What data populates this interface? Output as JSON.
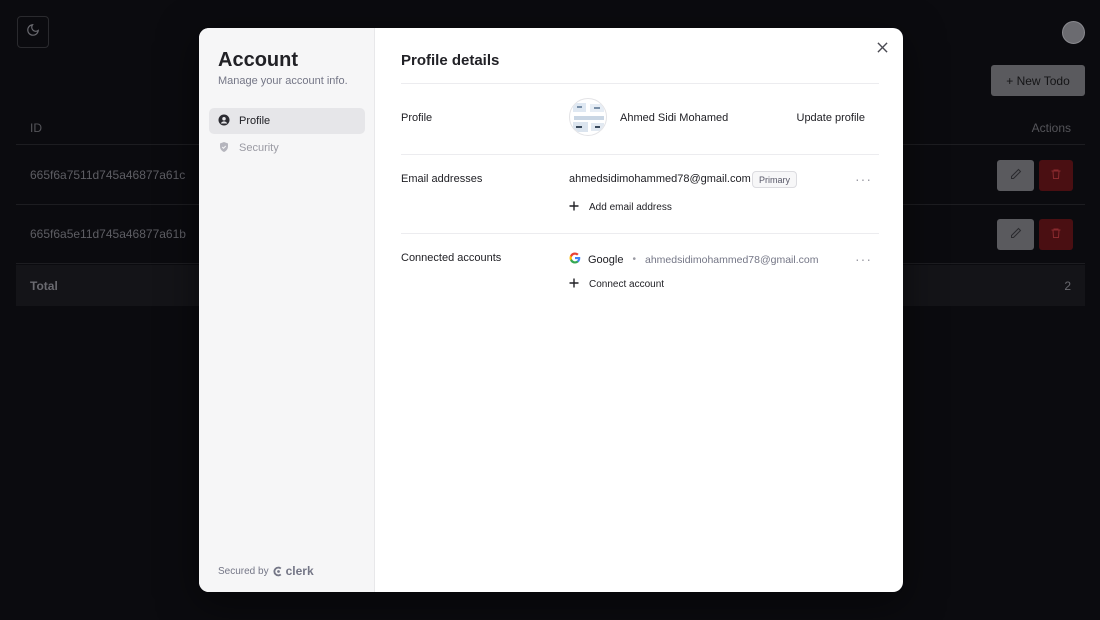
{
  "background": {
    "new_todo_label": "+ New Todo",
    "table": {
      "headers": [
        "ID",
        "Actions"
      ],
      "rows": [
        {
          "id": "665f6a7511d745a46877a61c"
        },
        {
          "id": "665f6a5e11d745a46877a61b"
        }
      ],
      "total_label": "Total",
      "total_value": "2"
    }
  },
  "modal": {
    "nav": {
      "title": "Account",
      "subtitle": "Manage your account info.",
      "items": [
        {
          "label": "Profile",
          "icon": "user-circle-icon",
          "active": true
        },
        {
          "label": "Security",
          "icon": "shield-icon",
          "active": false
        }
      ],
      "secured_by": "Secured by",
      "brand": "clerk"
    },
    "content": {
      "title": "Profile details",
      "profile": {
        "label": "Profile",
        "name": "Ahmed Sidi Mohamed",
        "update_label": "Update profile"
      },
      "email": {
        "label": "Email addresses",
        "address": "ahmedsidimohammed78@gmail.com",
        "badge": "Primary",
        "add_label": "Add email address"
      },
      "connected": {
        "label": "Connected accounts",
        "provider": "Google",
        "email": "ahmedsidimohammed78@gmail.com",
        "connect_label": "Connect account"
      }
    }
  },
  "colors": {
    "modal_bg": "#ffffff",
    "nav_bg": "#f6f6f7",
    "text_primary": "#212126",
    "text_muted": "#747686",
    "delete_red": "#4a0f12"
  }
}
